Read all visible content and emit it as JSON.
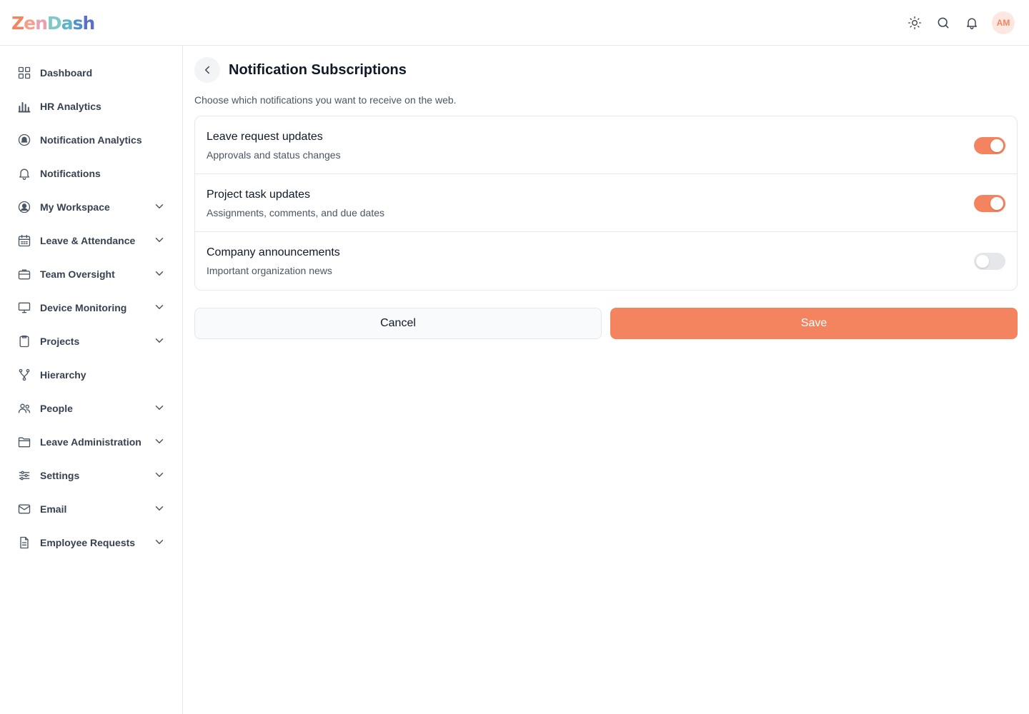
{
  "app": {
    "logo_letters": [
      {
        "ch": "Z",
        "color": "#f4845f"
      },
      {
        "ch": "e",
        "color": "#f59e8b"
      },
      {
        "ch": "n",
        "color": "#e9a0b0"
      },
      {
        "ch": "D",
        "color": "#7ec8c8"
      },
      {
        "ch": "a",
        "color": "#5fb3c7"
      },
      {
        "ch": "s",
        "color": "#4f8fd0"
      },
      {
        "ch": "h",
        "color": "#5a6fc9"
      }
    ],
    "accent_color": "#f4845f"
  },
  "topbar": {
    "icons": [
      "sun-icon",
      "search-icon",
      "bell-icon"
    ],
    "avatar_initials": "AM"
  },
  "sidebar": {
    "items": [
      {
        "label": "Dashboard",
        "icon": "grid-icon",
        "has_children": false
      },
      {
        "label": "HR Analytics",
        "icon": "bar-chart-icon",
        "has_children": false
      },
      {
        "label": "Notification Analytics",
        "icon": "bell-circle-icon",
        "has_children": false
      },
      {
        "label": "Notifications",
        "icon": "bell-icon",
        "has_children": false
      },
      {
        "label": "My Workspace",
        "icon": "user-circle-icon",
        "has_children": true
      },
      {
        "label": "Leave & Attendance",
        "icon": "calendar-icon",
        "has_children": true
      },
      {
        "label": "Team Oversight",
        "icon": "briefcase-icon",
        "has_children": true
      },
      {
        "label": "Device Monitoring",
        "icon": "monitor-icon",
        "has_children": true
      },
      {
        "label": "Projects",
        "icon": "clipboard-icon",
        "has_children": true
      },
      {
        "label": "Hierarchy",
        "icon": "branch-icon",
        "has_children": false
      },
      {
        "label": "People",
        "icon": "users-icon",
        "has_children": true
      },
      {
        "label": "Leave Administration",
        "icon": "folder-icon",
        "has_children": true
      },
      {
        "label": "Settings",
        "icon": "sliders-icon",
        "has_children": true
      },
      {
        "label": "Email",
        "icon": "mail-icon",
        "has_children": true
      },
      {
        "label": "Employee Requests",
        "icon": "document-icon",
        "has_children": true
      }
    ]
  },
  "main": {
    "title": "Notification Subscriptions",
    "subtitle": "Choose which notifications you want to receive on the web.",
    "subscriptions": [
      {
        "title": "Leave request updates",
        "description": "Approvals and status changes",
        "enabled": true
      },
      {
        "title": "Project task updates",
        "description": "Assignments, comments, and due dates",
        "enabled": true
      },
      {
        "title": "Company announcements",
        "description": "Important organization news",
        "enabled": false
      }
    ],
    "cancel_label": "Cancel",
    "save_label": "Save"
  }
}
